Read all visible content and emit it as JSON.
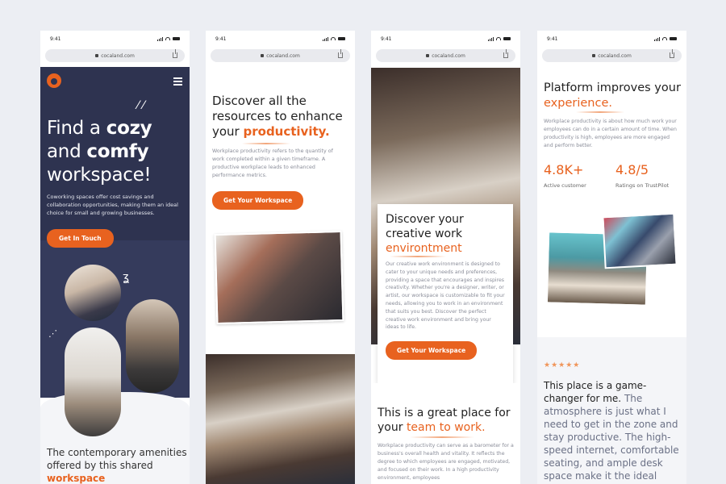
{
  "status": {
    "time": "9:41",
    "url": "cocaland.com"
  },
  "colors": {
    "accent": "#e8621f",
    "navy": "#2e3350",
    "background": "#eceef3"
  },
  "icons": [
    "logo-icon",
    "hamburger-menu-icon",
    "lock-icon",
    "share-icon",
    "signal-icon",
    "wifi-icon",
    "battery-icon",
    "star-icon"
  ],
  "screen1": {
    "title_pre": "Find a ",
    "title_b1": "cozy",
    "title_mid": "and ",
    "title_b2": "comfy",
    "title_post": "workspace!",
    "description": "Coworking spaces offer cost savings and collaboration opportunities, making them an ideal choice for small and growing businesses.",
    "cta": "Get In Touch",
    "section_heading": "The contemporary amenities offered by this shared ",
    "section_heading_accent": "workspace"
  },
  "screen2": {
    "title": "Discover all the resources to enhance your ",
    "title_accent": "productivity.",
    "description": "Workplace productivity refers to the quantity of work completed within a given timeframe. A productive workplace leads to enhanced performance metrics.",
    "cta": "Get Your Workspace"
  },
  "screen3": {
    "card_title": "Discover your creative work ",
    "card_title_accent": "environtment",
    "card_description": "Our creative work environment is designed to cater to your unique needs and preferences, providing a space that encourages and inspires creativity. Whether you're a designer, writer, or artist, our workspace is customizable to fit your needs, allowing you to work in an environment that suits you best. Discover the perfect creative work environment and bring your ideas to life.",
    "cta": "Get Your Workspace",
    "section_title": "This is a great place for your ",
    "section_title_accent": "team to work.",
    "section_description": "Workplace productivity can serve as a barometer for a business's overall health and vitality. It reflects the degree to which employees are engaged, motivated, and focused on their work. In a high productivity environment, employees"
  },
  "screen4": {
    "title": "Platform improves your ",
    "title_accent": "experience.",
    "description": "Workplace productivity is about how much work your employees can do in a certain amount of time. When productivity is high, employees are more engaged and perform better.",
    "stats": [
      {
        "value": "4.8K+",
        "label": "Active customer"
      },
      {
        "value": "4.8/5",
        "label": "Ratings on TrustPilot"
      }
    ],
    "rating_stars": "★★★★★",
    "rating": 5,
    "quote_lead": "This place is a game-changer for me.",
    "quote_rest": " The atmosphere is just what I need to get in the zone and stay productive. The high-speed internet, comfortable seating, and ample desk space make it the ideal"
  }
}
